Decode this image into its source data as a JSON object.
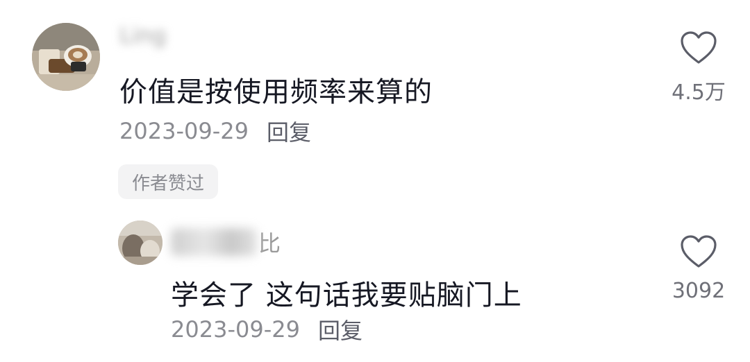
{
  "comments": [
    {
      "username_display": "Ling",
      "text": "价值是按使用频率来算的",
      "date": "2023-09-29",
      "reply_label": "回复",
      "badge": "作者赞过",
      "like_count": "4.5万"
    },
    {
      "username_visible_suffix": "比",
      "text": "学会了 这句话我要贴脑门上",
      "date": "2023-09-29",
      "reply_label": "回复",
      "like_count": "3092"
    }
  ],
  "colors": {
    "text_primary": "#161823",
    "text_secondary": "#8a8b91",
    "badge_background": "#f3f3f4",
    "heart_outline": "#5b5d68"
  },
  "icons": {
    "like": "heart-outline-icon",
    "avatar_main": "coffee-photo-avatar",
    "avatar_reply": "blurred-photo-avatar"
  }
}
